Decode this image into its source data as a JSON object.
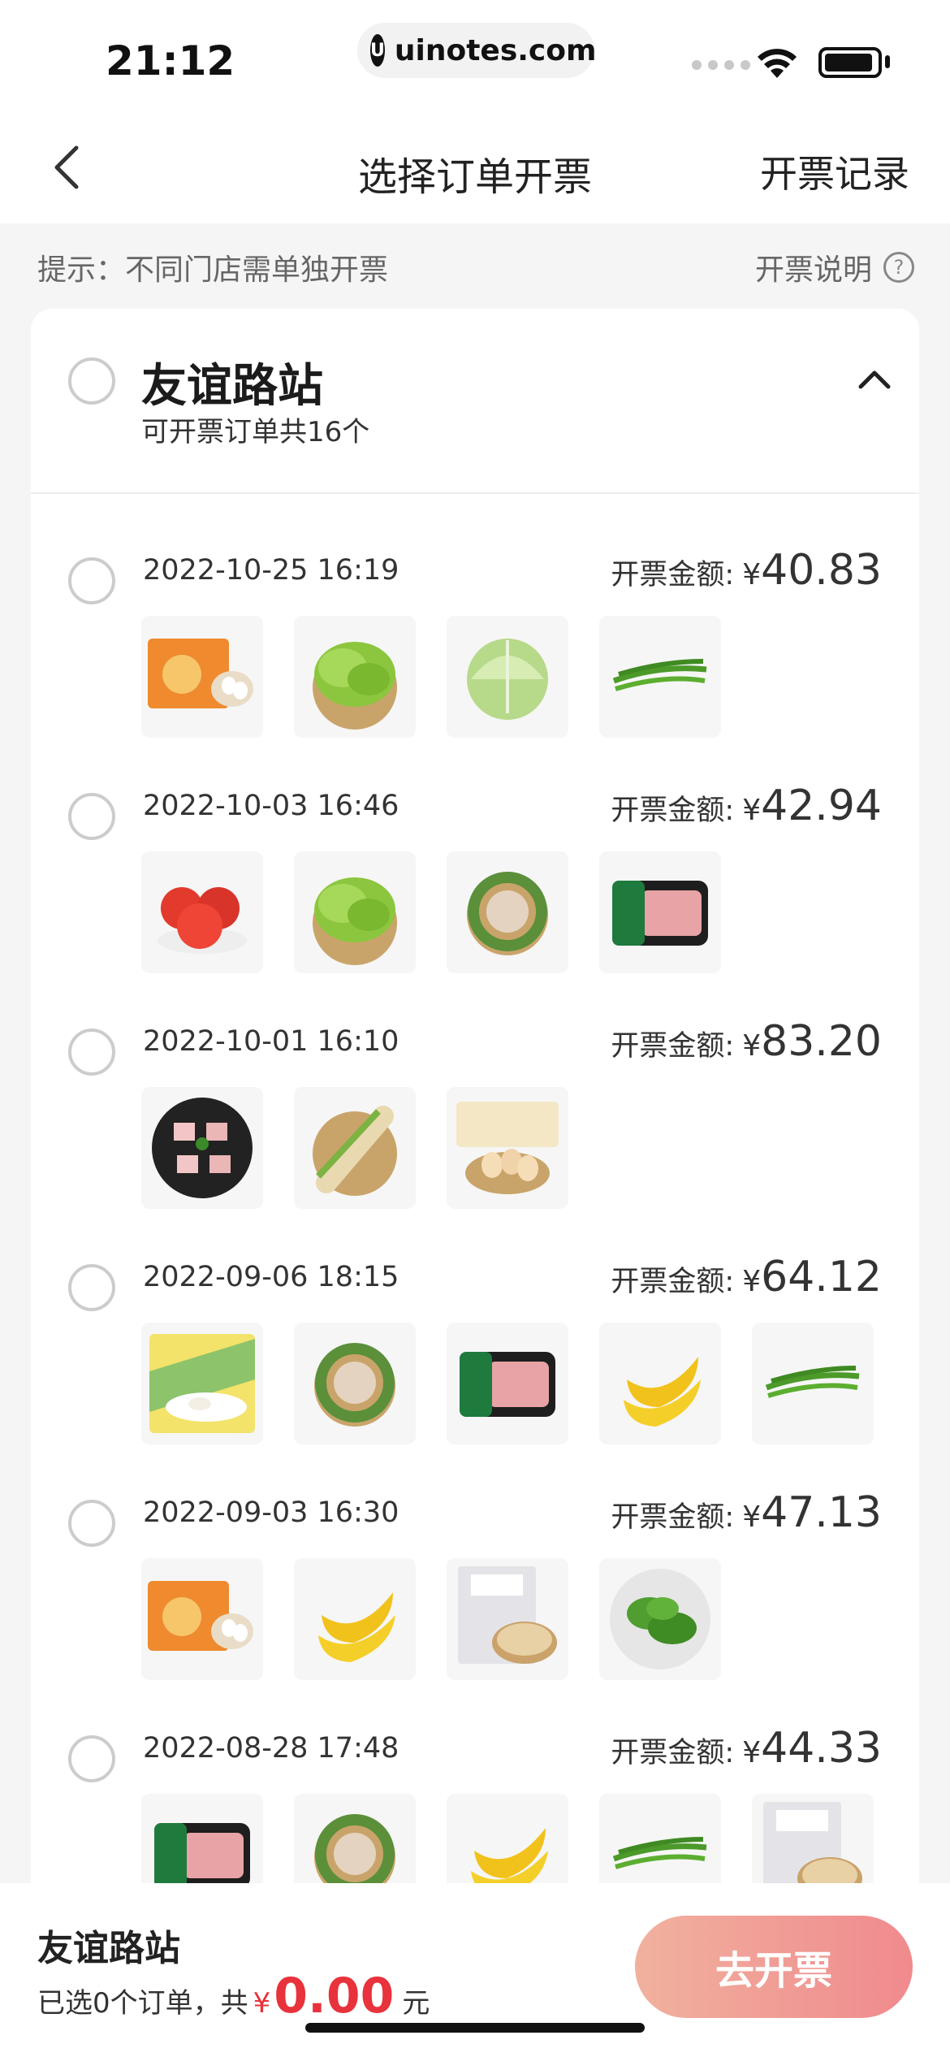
{
  "status_bar": {
    "time": "21:12",
    "url": "uinotes.com",
    "url_icon": "U"
  },
  "nav": {
    "title": "选择订单开票",
    "right_label": "开票记录",
    "back_icon": "chevron-left-icon"
  },
  "tips": {
    "text": "提示：不同门店需单独开票",
    "help_label": "开票说明",
    "help_icon": "?"
  },
  "store": {
    "name": "友谊路站",
    "count_text": "可开票订单共16个"
  },
  "amount_label": "开票金额:",
  "currency": "¥",
  "orders": [
    {
      "date": "2022-10-25 16:19",
      "amount": "40.83",
      "items": [
        "dumplings-pack",
        "lettuce",
        "cabbage",
        "green-beans"
      ]
    },
    {
      "date": "2022-10-03 16:46",
      "amount": "42.94",
      "items": [
        "tomatoes",
        "lettuce",
        "long-beans",
        "pork-tray"
      ]
    },
    {
      "date": "2022-10-01 16:10",
      "amount": "83.20",
      "items": [
        "pork-belly",
        "corn",
        "eggs-box"
      ]
    },
    {
      "date": "2022-09-06 18:15",
      "amount": "64.12",
      "items": [
        "frozen-dumplings",
        "long-beans",
        "pork-tray",
        "bananas",
        "green-beans"
      ]
    },
    {
      "date": "2022-09-03 16:30",
      "amount": "47.13",
      "items": [
        "dumplings-pack",
        "bananas",
        "pancake-pack",
        "green-peppers"
      ]
    },
    {
      "date": "2022-08-28 17:48",
      "amount": "44.33",
      "items": [
        "pork-tray",
        "long-beans",
        "bananas",
        "green-beans",
        "pancake-pack"
      ]
    }
  ],
  "bottom": {
    "store": "友谊路站",
    "summary_prefix": "已选0个订单，共",
    "currency": "¥",
    "amount": "0.00",
    "unit": "元",
    "button": "去开票"
  },
  "colors": {
    "accent_red": "#e8323c",
    "button_gradient_start": "#f1b19e",
    "button_gradient_end": "#f08a8e"
  }
}
